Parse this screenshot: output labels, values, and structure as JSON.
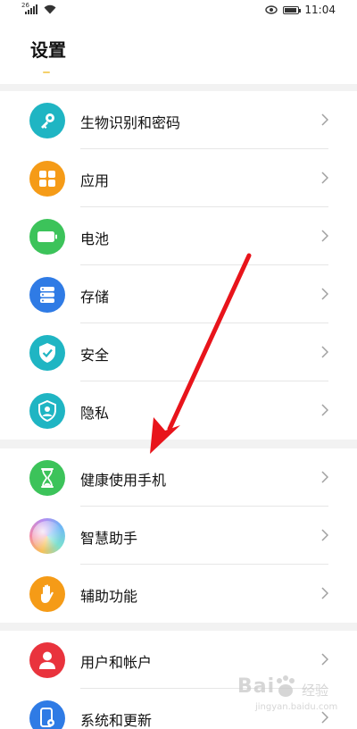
{
  "status_bar": {
    "network_label": "26",
    "time": "11:04",
    "battery_level_fraction": 0.9
  },
  "header": {
    "title": "设置"
  },
  "groups": [
    {
      "items": [
        {
          "label": "生物识别和密码",
          "icon": "key-icon",
          "color": "#1fb5c3"
        },
        {
          "label": "应用",
          "icon": "apps-grid-icon",
          "color": "#f59b17"
        },
        {
          "label": "电池",
          "icon": "battery-icon",
          "color": "#3cc35a"
        },
        {
          "label": "存储",
          "icon": "storage-icon",
          "color": "#2f7be5"
        },
        {
          "label": "安全",
          "icon": "shield-check-icon",
          "color": "#1fb5c3"
        },
        {
          "label": "隐私",
          "icon": "privacy-shield-icon",
          "color": "#1fb5c3"
        }
      ]
    },
    {
      "items": [
        {
          "label": "健康使用手机",
          "icon": "hourglass-icon",
          "color": "#3cc35a"
        },
        {
          "label": "智慧助手",
          "icon": "assistant-orb-icon",
          "color": "#e9a0c8"
        },
        {
          "label": "辅助功能",
          "icon": "hand-icon",
          "color": "#f59b17"
        }
      ]
    },
    {
      "items": [
        {
          "label": "用户和帐户",
          "icon": "user-icon",
          "color": "#e9333d"
        },
        {
          "label": "系统和更新",
          "icon": "phone-gear-icon",
          "color": "#2f7be5"
        }
      ]
    }
  ],
  "annotation": {
    "arrow_color": "#e8141b"
  },
  "watermark": {
    "brand": "Bai",
    "brand_cn": "经验",
    "url": "jingyan.baidu.com"
  }
}
